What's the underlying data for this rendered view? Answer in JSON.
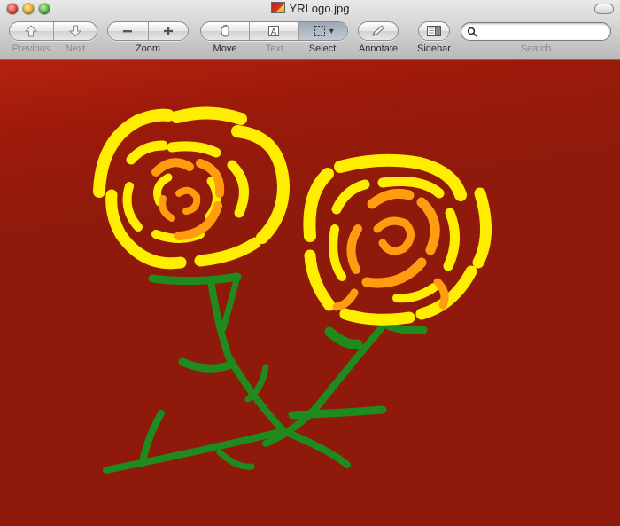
{
  "window": {
    "title": "YRLogo.jpg"
  },
  "toolbar": {
    "previous_label": "Previous",
    "next_label": "Next",
    "zoom_label": "Zoom",
    "move_label": "Move",
    "text_label": "Text",
    "select_label": "Select",
    "annotate_label": "Annotate",
    "sidebar_label": "Sidebar",
    "search_label": "Search",
    "search_value": "",
    "select_dropdown_glyph": "▾"
  },
  "icons": {
    "previous": "up-arrow-icon",
    "next": "down-arrow-icon",
    "zoom_out": "minus-icon",
    "zoom_in": "plus-icon",
    "move": "hand-icon",
    "text": "text-tool-icon",
    "select": "marquee-select-icon",
    "annotate": "pencil-icon",
    "sidebar": "sidebar-icon",
    "search": "magnifier-icon"
  },
  "colors": {
    "canvas_bg": "#8f1a0b",
    "petal_outer": "#ffee00",
    "petal_inner": "#ff9c10",
    "stem": "#1f8a1d"
  }
}
